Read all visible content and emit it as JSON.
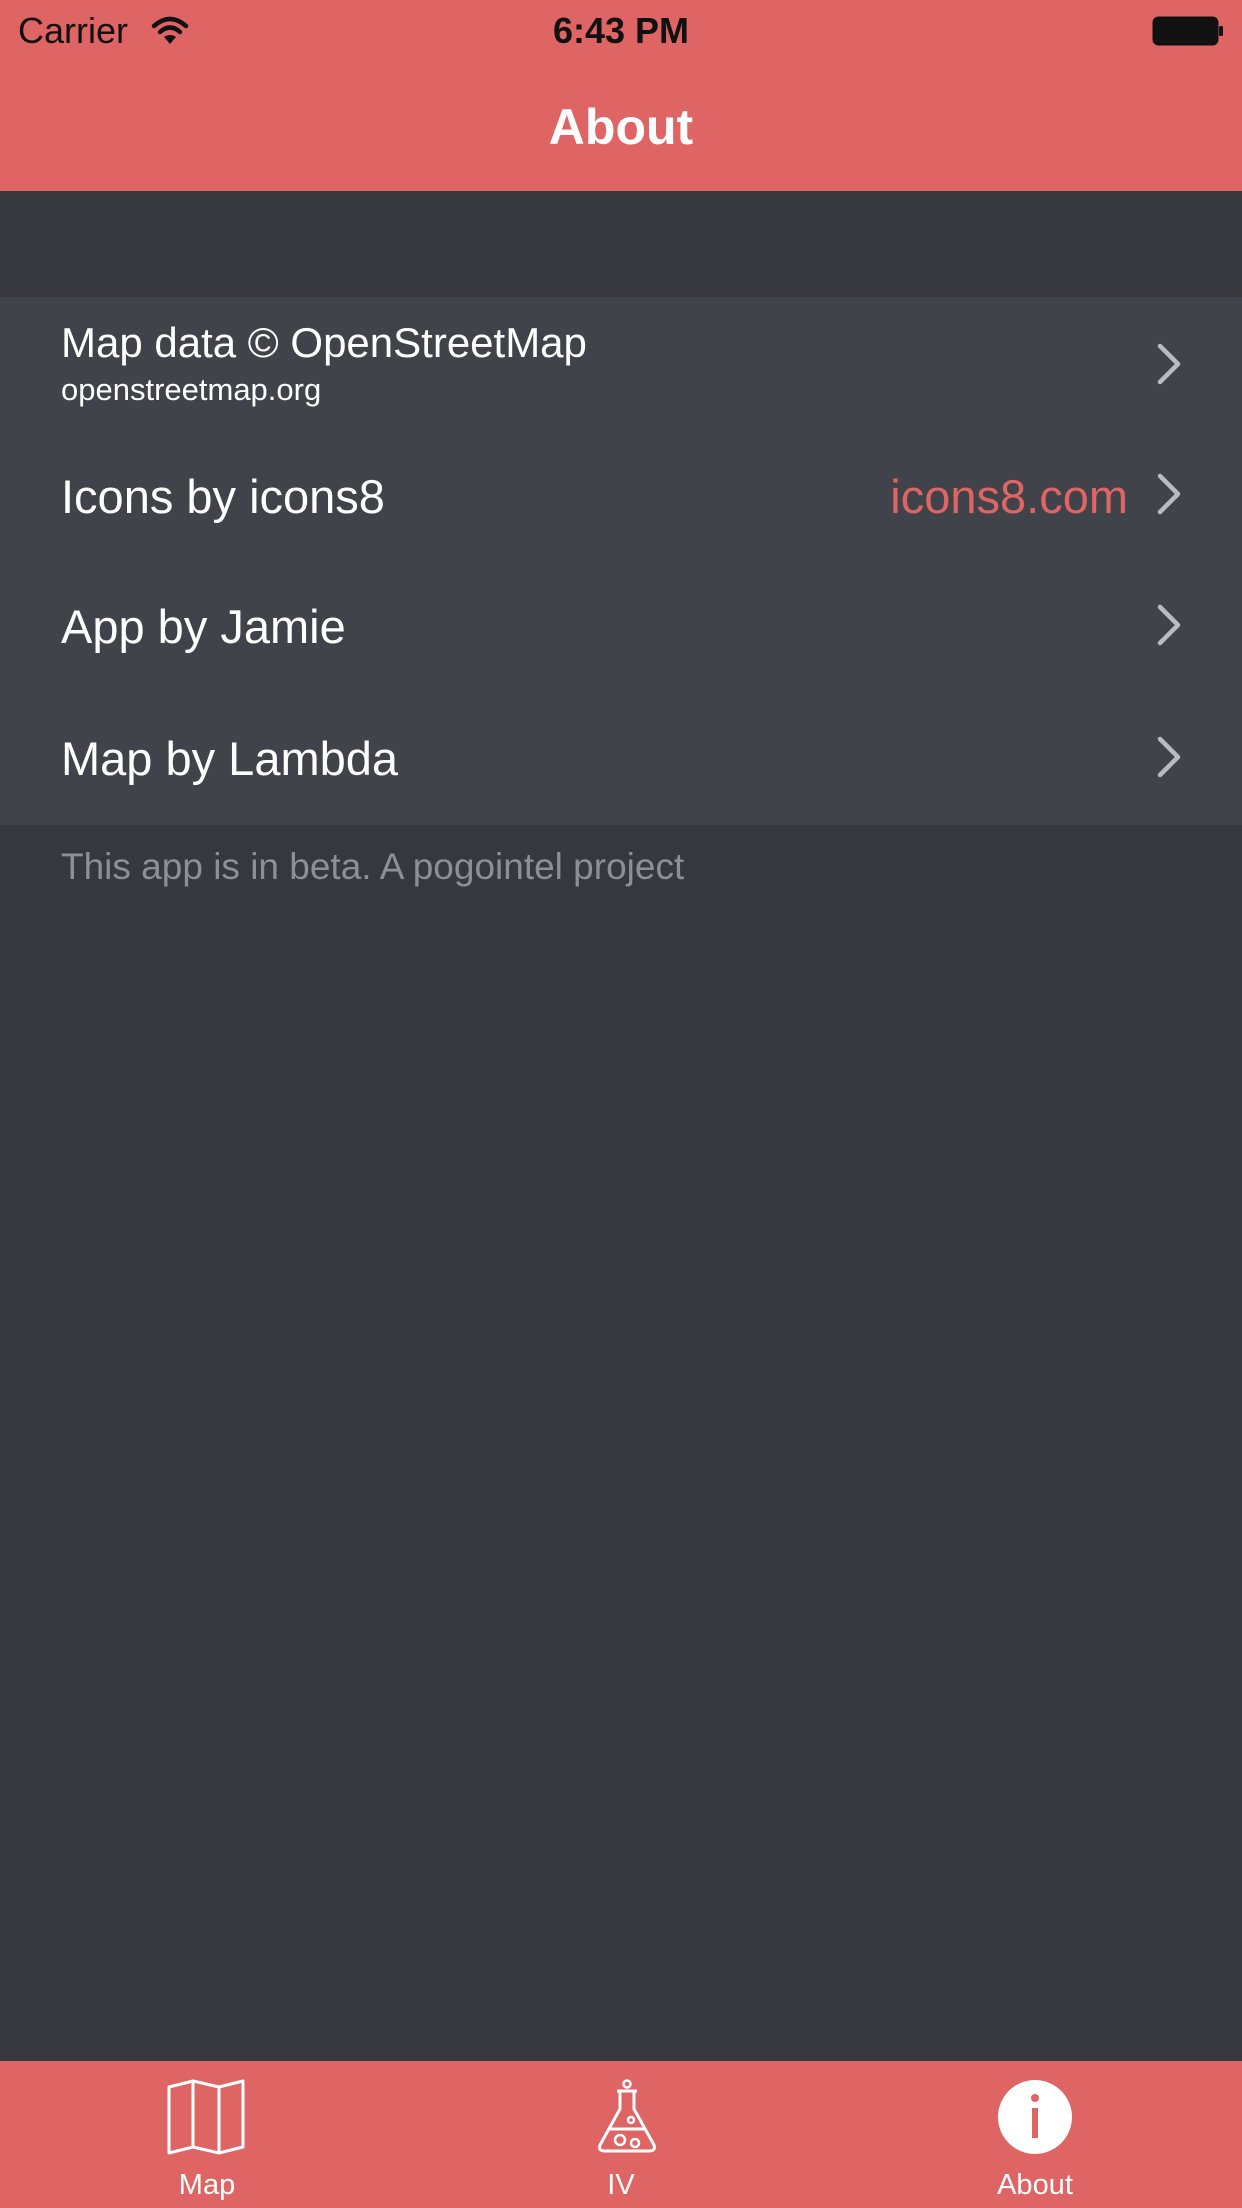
{
  "status_bar": {
    "carrier": "Carrier",
    "time": "6:43 PM"
  },
  "nav": {
    "title": "About"
  },
  "rows": [
    {
      "title": "Map data © OpenStreetMap",
      "subtitle": "openstreetmap.org",
      "detail": ""
    },
    {
      "title": "Icons by icons8",
      "subtitle": "",
      "detail": "icons8.com"
    },
    {
      "title": "App by Jamie",
      "subtitle": "",
      "detail": ""
    },
    {
      "title": "Map by Lambda",
      "subtitle": "",
      "detail": ""
    }
  ],
  "footer": "This app is in beta. A pogointel project",
  "tabs": [
    {
      "label": "Map",
      "icon": "map-icon"
    },
    {
      "label": "IV",
      "icon": "flask-icon"
    },
    {
      "label": "About",
      "icon": "info-icon",
      "selected": true
    }
  ],
  "colors": {
    "accent": "#df6464",
    "background": "#36383d",
    "cell": "#404349",
    "footer_text": "#8c8f95"
  }
}
